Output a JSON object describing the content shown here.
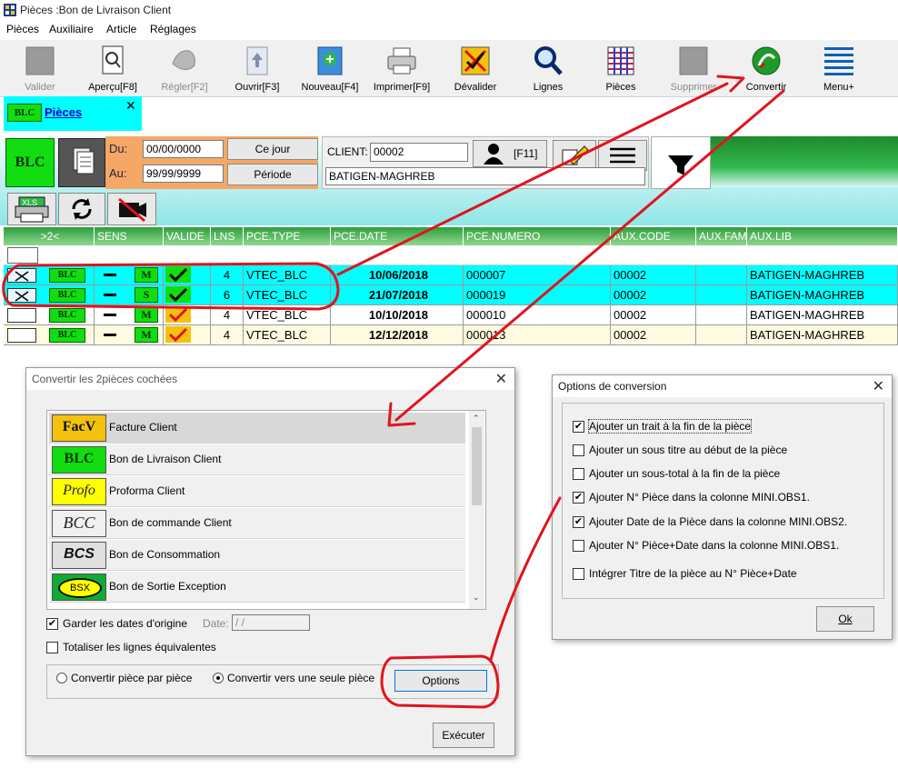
{
  "window": {
    "title": "Pièces :Bon de Livraison Client"
  },
  "menu": [
    "Pièces",
    "Auxiliaire",
    "Article",
    "Réglages"
  ],
  "toolbar": [
    {
      "label": "Valider",
      "icon": "valider-icon",
      "disabled": true
    },
    {
      "label": "Aperçu[F8]",
      "icon": "preview-icon",
      "disabled": false
    },
    {
      "label": "Régler[F2]",
      "icon": "settle-icon",
      "disabled": true
    },
    {
      "label": "Ouvrir[F3]",
      "icon": "open-icon",
      "disabled": false
    },
    {
      "label": "Nouveau[F4]",
      "icon": "new-icon",
      "disabled": false
    },
    {
      "label": "Imprimer[F9]",
      "icon": "printer-icon",
      "disabled": false
    },
    {
      "label": "Dévalider",
      "icon": "invalidate-icon",
      "disabled": false
    },
    {
      "label": "Lignes",
      "icon": "search-icon",
      "disabled": false
    },
    {
      "label": "Pièces",
      "icon": "pieces-icon",
      "disabled": false
    },
    {
      "label": "Supprimer",
      "icon": "delete-icon",
      "disabled": true
    },
    {
      "label": "Convertir",
      "icon": "convert-icon",
      "disabled": false
    },
    {
      "label": "Menu+",
      "icon": "menu-icon",
      "disabled": false
    }
  ],
  "tab": {
    "badge": "BLC",
    "label": "Pièces",
    "close": "✕"
  },
  "filter": {
    "badge": "BLC",
    "du_label": "Du:",
    "du_value": "00/00/0000",
    "au_label": "Au:",
    "au_value": "99/99/9999",
    "ce_jour": "Ce jour",
    "periode": "Période",
    "client_label": "CLIENT:",
    "client_code": "00002",
    "f11": "[F11]",
    "client_name": "BATIGEN-MAGHREB"
  },
  "grid": {
    "columns": [
      ">2<",
      "SENS",
      "VALIDE",
      "LNS",
      "PCE.TYPE",
      "PCE.DATE",
      "PCE.NUMERO",
      "AUX.CODE",
      "AUX.FAM",
      "AUX.LIB"
    ],
    "rows": [
      {
        "badge": "BLC",
        "sens": "M",
        "lns": "4",
        "type": "VTEC_BLC",
        "date": "10/06/2018",
        "num": "000007",
        "code": "00002",
        "fam": "",
        "lib": "BATIGEN-MAGHREB",
        "bg": "#00ffff",
        "checked": true
      },
      {
        "badge": "BLC",
        "sens": "S",
        "lns": "6",
        "type": "VTEC_BLC",
        "date": "21/07/2018",
        "num": "000019",
        "code": "00002",
        "fam": "",
        "lib": "BATIGEN-MAGHREB",
        "bg": "#00ffff",
        "checked": true
      },
      {
        "badge": "BLC",
        "sens": "M",
        "lns": "4",
        "type": "VTEC_BLC",
        "date": "10/10/2018",
        "num": "000010",
        "code": "00002",
        "fam": "",
        "lib": "BATIGEN-MAGHREB",
        "bg": "#ffffff",
        "checked": false
      },
      {
        "badge": "BLC",
        "sens": "M",
        "lns": "4",
        "type": "VTEC_BLC",
        "date": "12/12/2018",
        "num": "000013",
        "code": "00002",
        "fam": "",
        "lib": "BATIGEN-MAGHREB",
        "bg": "#fffbe0",
        "checked": false
      }
    ]
  },
  "convert_dialog": {
    "title": "Convertir les 2pièces cochées",
    "items": [
      {
        "badge": "FacV",
        "label": "Facture Client",
        "selected": true
      },
      {
        "badge": "BLC",
        "label": "Bon de Livraison Client",
        "selected": false
      },
      {
        "badge": "Profo",
        "label": "Proforma Client",
        "selected": false
      },
      {
        "badge": "BCC",
        "label": "Bon de commande Client",
        "selected": false
      },
      {
        "badge": "BCS",
        "label": "Bon de Consommation",
        "selected": false
      },
      {
        "badge": "BSX",
        "label": "Bon de Sortie Exception",
        "selected": false
      }
    ],
    "keep_dates": "Garder les dates d'origine",
    "keep_dates_checked": true,
    "date_label": "Date:",
    "date_value": " /  /",
    "total_lines": "Totaliser les lignes équivalentes",
    "total_lines_checked": false,
    "radio_piece": "Convertir pièce par pièce",
    "radio_single": "Convertir vers une seule pièce",
    "options_button": "Options",
    "execute_button": "Exécuter"
  },
  "options_dialog": {
    "title": "Options de conversion",
    "options": [
      {
        "label": "Ajouter un trait à la fin de la pièce",
        "checked": true
      },
      {
        "label": "Ajouter un sous titre au début de la pièce",
        "checked": false
      },
      {
        "label": "Ajouter un sous-total à la fin de la pièce",
        "checked": false
      },
      {
        "label": "Ajouter N° Pièce dans la colonne MINI.OBS1.",
        "checked": true
      },
      {
        "label": "Ajouter Date de la Pièce dans la colonne MINI.OBS2.",
        "checked": true
      },
      {
        "label": "Ajouter N° Pièce+Date dans la colonne MINI.OBS1.",
        "checked": false
      },
      {
        "label": "Intégrer Titre de la pièce au N° Pièce+Date",
        "checked": false
      }
    ],
    "ok_button": "Ok"
  },
  "colors": {
    "accent_cyan": "#00ffff",
    "grid_header_green": "#2e9e3e",
    "annotation_red": "#e0141e",
    "blc_green": "#11dd11"
  }
}
